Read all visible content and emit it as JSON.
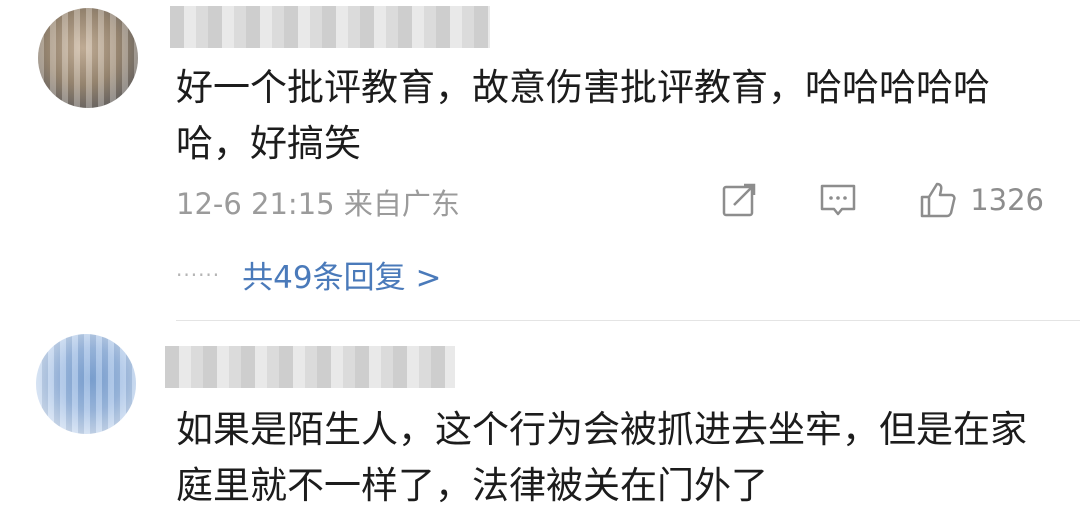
{
  "comments": [
    {
      "text": "好一个批评教育，故意伤害批评教育，哈哈哈哈哈哈，好搞笑",
      "date": "12-6 21:15",
      "location": "来自广东",
      "likes": "1326",
      "replies": "共49条回复 >",
      "reply_dots": "······"
    },
    {
      "text": "如果是陌生人，这个行为会被抓进去坐牢，但是在家庭里就不一样了，法律被关在门外了"
    }
  ],
  "icons": [
    "share-icon",
    "comment-icon",
    "like-icon"
  ],
  "colors": {
    "link": "#4a7aba",
    "meta": "#9b9b9b",
    "text": "#1c1c1c"
  }
}
